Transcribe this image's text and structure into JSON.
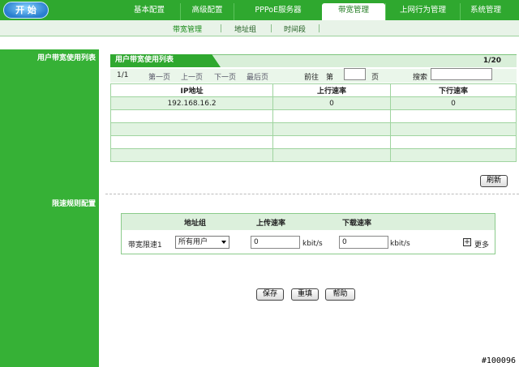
{
  "logo": {
    "label": "开 始"
  },
  "nav": {
    "tabs": [
      {
        "label": "基本配置",
        "width": 76
      },
      {
        "label": "高级配置",
        "width": 66
      },
      {
        "label": "PPPoE服务器",
        "width": 109
      },
      {
        "label": "带宽管理",
        "width": 78,
        "active": true
      },
      {
        "label": "上网行为管理",
        "width": 92
      },
      {
        "label": "系统管理",
        "width": 63
      }
    ]
  },
  "subnav": {
    "items": [
      "带宽管理",
      "地址组",
      "时间段"
    ]
  },
  "left": {
    "list_label": "用户带宽使用列表",
    "rate_label": "限速规则配置"
  },
  "list": {
    "tab_label": "用户带宽使用列表",
    "count": "1/20",
    "pager": {
      "position": "1/1",
      "first": "第一页",
      "prev": "上一页",
      "next": "下一页",
      "last": "最后页",
      "goto_pre": "前往",
      "goto_mid": "第",
      "goto_post": "页",
      "search_label": "搜索",
      "page_value": "",
      "search_value": ""
    },
    "columns": [
      "IP地址",
      "上行速率",
      "下行速率"
    ],
    "rows": [
      [
        "192.168.16.2",
        "0",
        "0"
      ],
      [
        "",
        "",
        ""
      ],
      [
        "",
        "",
        ""
      ],
      [
        "",
        "",
        ""
      ],
      [
        "",
        "",
        ""
      ]
    ],
    "refresh_label": "刷新"
  },
  "rate": {
    "columns": {
      "group": "地址组",
      "up": "上传速率",
      "down": "下载速率"
    },
    "row": {
      "name": "带宽限速1",
      "group_selected": "所有用户",
      "up_value": "0",
      "down_value": "0",
      "unit": "kbit/s",
      "more_label": "更多",
      "plus": "+"
    }
  },
  "buttons": {
    "save": "保存",
    "reset": "重填",
    "help": "帮助"
  },
  "watermark": "#100096",
  "colors": {
    "accent": "#2fa82f",
    "light": "#e1f3e1"
  }
}
